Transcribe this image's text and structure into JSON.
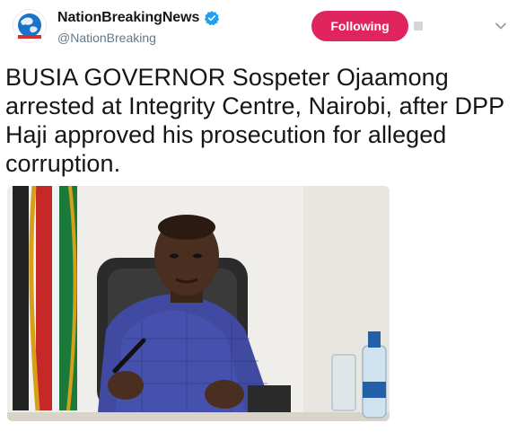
{
  "account": {
    "display_name": "NationBreakingNews",
    "handle": "@NationBreaking",
    "verified": true,
    "avatar_icon": "nation-globe-logo-icon"
  },
  "actions": {
    "follow_label": "Following",
    "follow_color": "#e0245e"
  },
  "tweet": {
    "text": "BUSIA GOVERNOR Sospeter Ojaamong\narrested at Integrity Centre, Nairobi, after DPP\nHaji approved his prosecution for alleged\ncorruption."
  },
  "media": {
    "type": "photo",
    "alt_icon": "governor-photo-icon"
  },
  "colors": {
    "text": "#14171a",
    "secondary": "#657786",
    "verified_blue": "#1da1f2"
  }
}
